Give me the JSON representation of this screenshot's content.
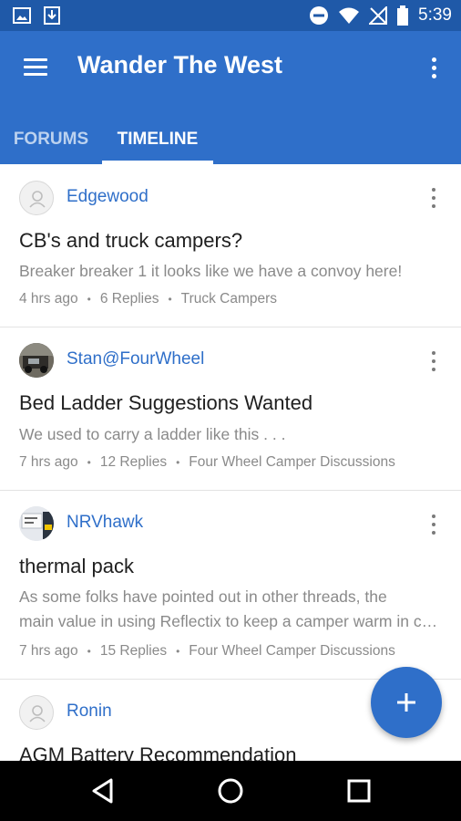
{
  "status_bar": {
    "time": "5:39",
    "icons": [
      "image-icon",
      "download-icon",
      "do-not-disturb-icon",
      "wifi-icon",
      "no-signal-icon",
      "battery-icon"
    ]
  },
  "app_bar": {
    "title": "Wander The West",
    "color": "#2f6fc9"
  },
  "tabs": [
    {
      "label": "FORUMS",
      "active": false
    },
    {
      "label": "TIMELINE",
      "active": true
    }
  ],
  "posts": [
    {
      "author": "Edgewood",
      "title": "CB's and truck campers?",
      "excerpt": "Breaker breaker 1 it looks like we have a convoy here!",
      "time": "4 hrs ago",
      "replies": "6 Replies",
      "forum": "Truck Campers"
    },
    {
      "author": "Stan@FourWheel",
      "title": "Bed Ladder Suggestions Wanted",
      "excerpt": "We used to carry a ladder like this . . .",
      "time": "7 hrs ago",
      "replies": "12 Replies",
      "forum": "Four Wheel Camper Discussions"
    },
    {
      "author": "NRVhawk",
      "title": "thermal pack",
      "excerpt_line1": "As some folks have pointed out in other threads, the",
      "excerpt_line2": "main value in using Reflectix to keep a camper warm in cold weather",
      "time": "7 hrs ago",
      "replies": "15 Replies",
      "forum": "Four Wheel Camper Discussions"
    },
    {
      "author": "Ronin",
      "title": "AGM Battery Recommendation"
    }
  ],
  "fab": {
    "icon": "plus-icon"
  },
  "nav_bar": {
    "icons": [
      "back-icon",
      "home-icon",
      "recents-icon"
    ]
  }
}
